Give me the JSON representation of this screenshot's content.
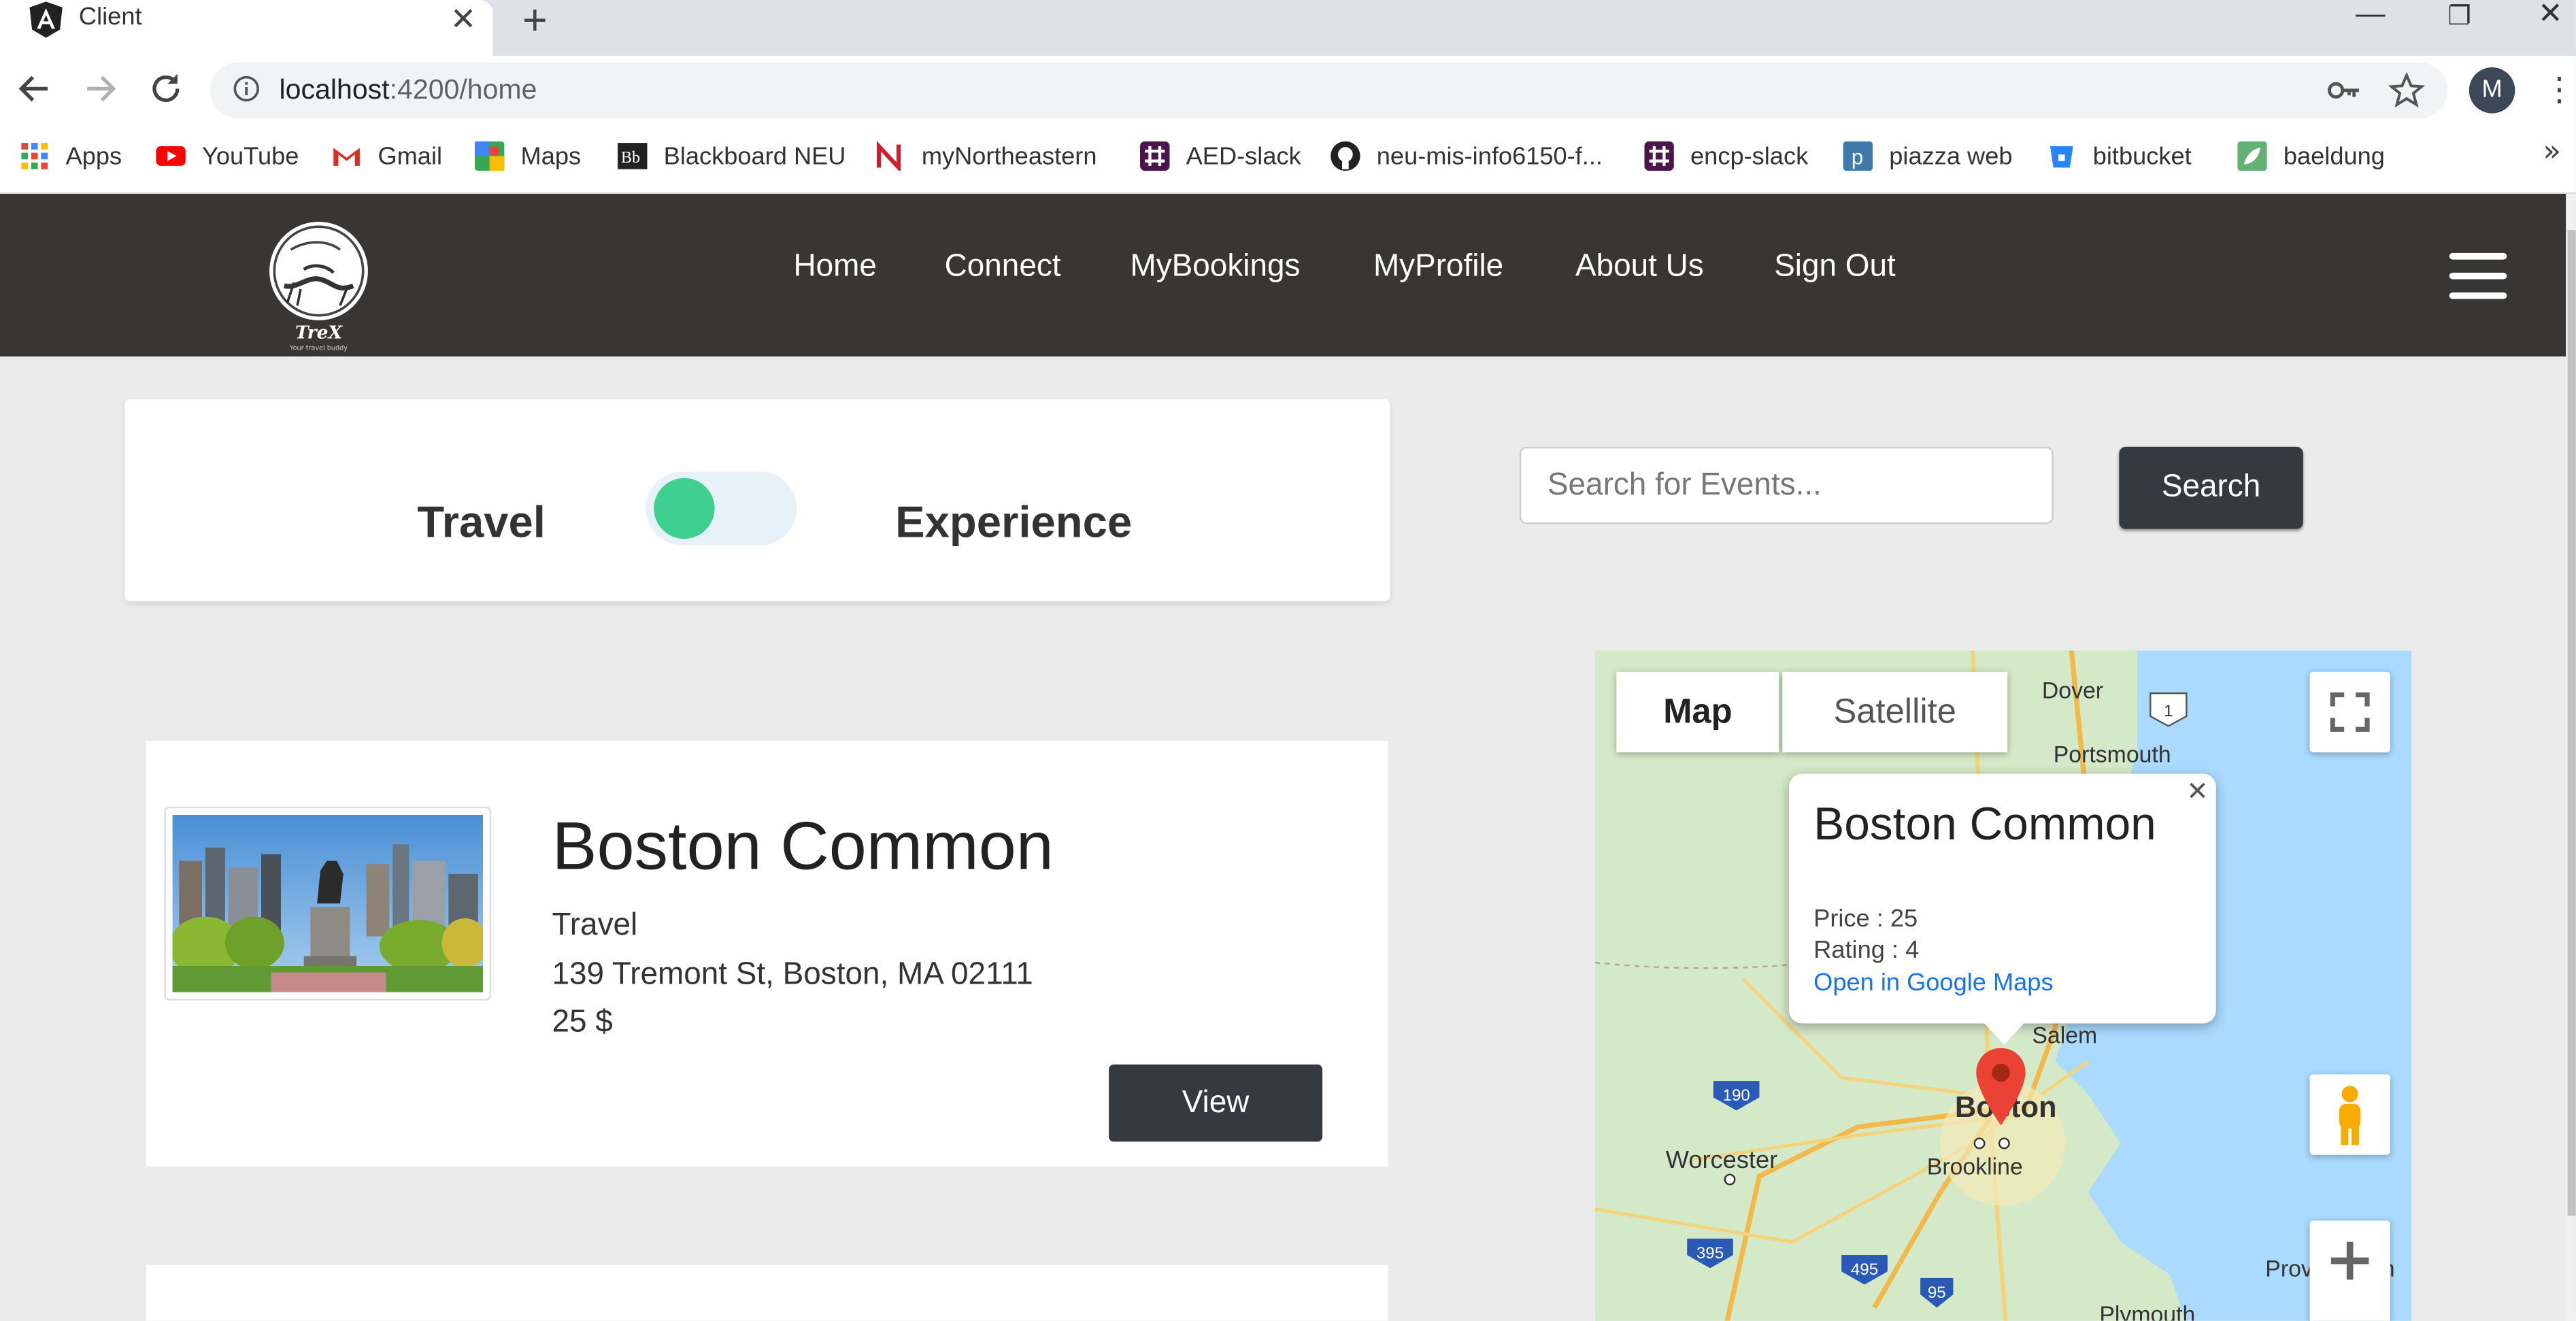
{
  "browser": {
    "tab_title": "Client",
    "url_host": "localhost",
    "url_path": ":4200/home",
    "profile_initial": "M",
    "bookmarks": [
      {
        "label": "Apps",
        "icon": "apps-grid-icon"
      },
      {
        "label": "YouTube",
        "icon": "youtube-icon"
      },
      {
        "label": "Gmail",
        "icon": "gmail-icon"
      },
      {
        "label": "Maps",
        "icon": "maps-icon"
      },
      {
        "label": "Blackboard NEU",
        "icon": "blackboard-icon"
      },
      {
        "label": "myNortheastern",
        "icon": "northeastern-icon"
      },
      {
        "label": "AED-slack",
        "icon": "slack-icon"
      },
      {
        "label": "neu-mis-info6150-f...",
        "icon": "github-icon"
      },
      {
        "label": "encp-slack",
        "icon": "slack-icon"
      },
      {
        "label": "piazza web",
        "icon": "piazza-icon"
      },
      {
        "label": "bitbucket",
        "icon": "bitbucket-icon"
      },
      {
        "label": "baeldung",
        "icon": "baeldung-icon"
      }
    ]
  },
  "site": {
    "logo_text": "TreX",
    "logo_tagline": "Your travel buddy",
    "nav": [
      "Home",
      "Connect",
      "MyBookings",
      "MyProfile",
      "About Us",
      "Sign Out"
    ]
  },
  "toggle": {
    "left_label": "Travel",
    "right_label": "Experience",
    "state": "Travel"
  },
  "search": {
    "placeholder": "Search for Events...",
    "button_label": "Search"
  },
  "event": {
    "title": "Boston Common",
    "type": "Travel",
    "address": "139 Tremont St, Boston, MA 02111",
    "price": "25 $",
    "button_label": "View"
  },
  "map": {
    "type_map": "Map",
    "type_satellite": "Satellite",
    "labels": [
      "Dover",
      "Portsmouth",
      "Salem",
      "Boston",
      "Brookline",
      "Worcester",
      "Plymouth",
      "Prov",
      "n"
    ],
    "highway_shields": [
      "1",
      "190",
      "395",
      "495",
      "95"
    ],
    "info": {
      "title": "Boston Common",
      "price": "Price : 25",
      "rating": "Rating : 4",
      "link": "Open in Google Maps"
    }
  },
  "colors": {
    "nav_bg": "#383634",
    "toggle_knob": "#3fcf8e",
    "button_dark": "#343a40",
    "map_marker": "#ea4335",
    "link_blue": "#1a73e8"
  }
}
